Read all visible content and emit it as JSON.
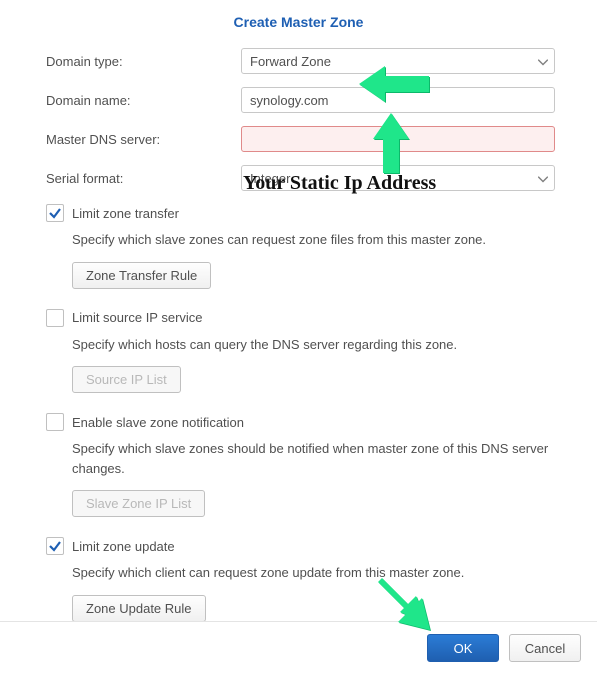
{
  "title": "Create Master Zone",
  "fields": {
    "domain_type": {
      "label": "Domain type:",
      "value": "Forward Zone"
    },
    "domain_name": {
      "label": "Domain name:",
      "value": "synology.com"
    },
    "master_dns": {
      "label": "Master DNS server:",
      "value": ""
    },
    "serial_format": {
      "label": "Serial format:",
      "value": "Integer"
    }
  },
  "sections": {
    "limit_transfer": {
      "label": "Limit zone transfer",
      "checked": true,
      "helper": "Specify which slave zones can request zone files from this master zone.",
      "button": "Zone Transfer Rule"
    },
    "limit_source_ip": {
      "label": "Limit source IP service",
      "checked": false,
      "helper": "Specify which hosts can query the DNS server regarding this zone.",
      "button": "Source IP List"
    },
    "enable_slave_notify": {
      "label": "Enable slave zone notification",
      "checked": false,
      "helper": "Specify which slave zones should be notified when master zone of this DNS server changes.",
      "button": "Slave Zone IP List"
    },
    "limit_update": {
      "label": "Limit zone update",
      "checked": true,
      "helper": "Specify which client can request zone update from this master zone.",
      "button": "Zone Update Rule"
    }
  },
  "footer": {
    "ok": "OK",
    "cancel": "Cancel"
  },
  "annotation": "Your Static Ip Address"
}
